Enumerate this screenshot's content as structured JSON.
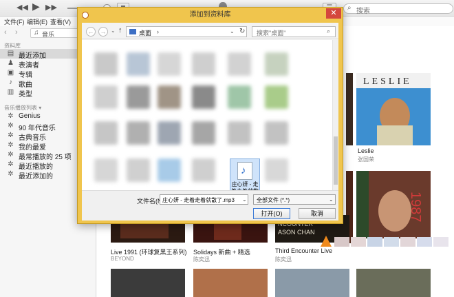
{
  "toolbar": {
    "rewind_icon": "rewind-icon",
    "play_icon": "play-icon",
    "forward_icon": "forward-icon",
    "search_placeholder": "搜索"
  },
  "menu": [
    "文件(F)",
    "编辑(E)",
    "查看(V)"
  ],
  "sidebar": {
    "library_selector": "音乐",
    "library_section": "资料库",
    "library_items": [
      {
        "label": "最近添加",
        "icon": "recent-icon",
        "selected": true
      },
      {
        "label": "表演者",
        "icon": "artist-icon",
        "selected": false
      },
      {
        "label": "专辑",
        "icon": "album-icon",
        "selected": false
      },
      {
        "label": "歌曲",
        "icon": "note-icon",
        "selected": false
      },
      {
        "label": "类型",
        "icon": "genre-icon",
        "selected": false
      }
    ],
    "playlists_section": "音乐播放列表 ▾",
    "playlist_items": [
      {
        "label": "Genius"
      },
      {
        "label": "90 年代音乐"
      },
      {
        "label": "古典音乐"
      },
      {
        "label": "我的最爱"
      },
      {
        "label": "最常播放的 25 项"
      },
      {
        "label": "最近播放的"
      },
      {
        "label": "最近添加的"
      }
    ]
  },
  "albums": [
    {
      "title": "Leslie",
      "artist": "张国荣",
      "cover": "#3d8fd0"
    },
    {
      "title": "Live 1991 (环球复黑王系列)",
      "artist": "BEYOND",
      "cover": "#2b1a12"
    },
    {
      "title": "Solidays 新曲 + 精选",
      "artist": "陈奕迅",
      "cover": "#3a1410"
    },
    {
      "title": "Third Encounter Live",
      "artist": "陈奕迅",
      "cover": "#1f1a14"
    }
  ],
  "dialog": {
    "title": "添加到资料库",
    "close": "✕",
    "address": "桌面",
    "search_placeholder": "搜索\"桌面\"",
    "selected_file": "庄心妍 - 走着走着就散了.mp3",
    "filename_label": "文件名(N):",
    "filename_value": "庄心妍 - 走着走着就散了.mp3",
    "filetype_value": "全部文件 (*.*)",
    "open_button": "打开(O)",
    "cancel_button": "取消"
  }
}
